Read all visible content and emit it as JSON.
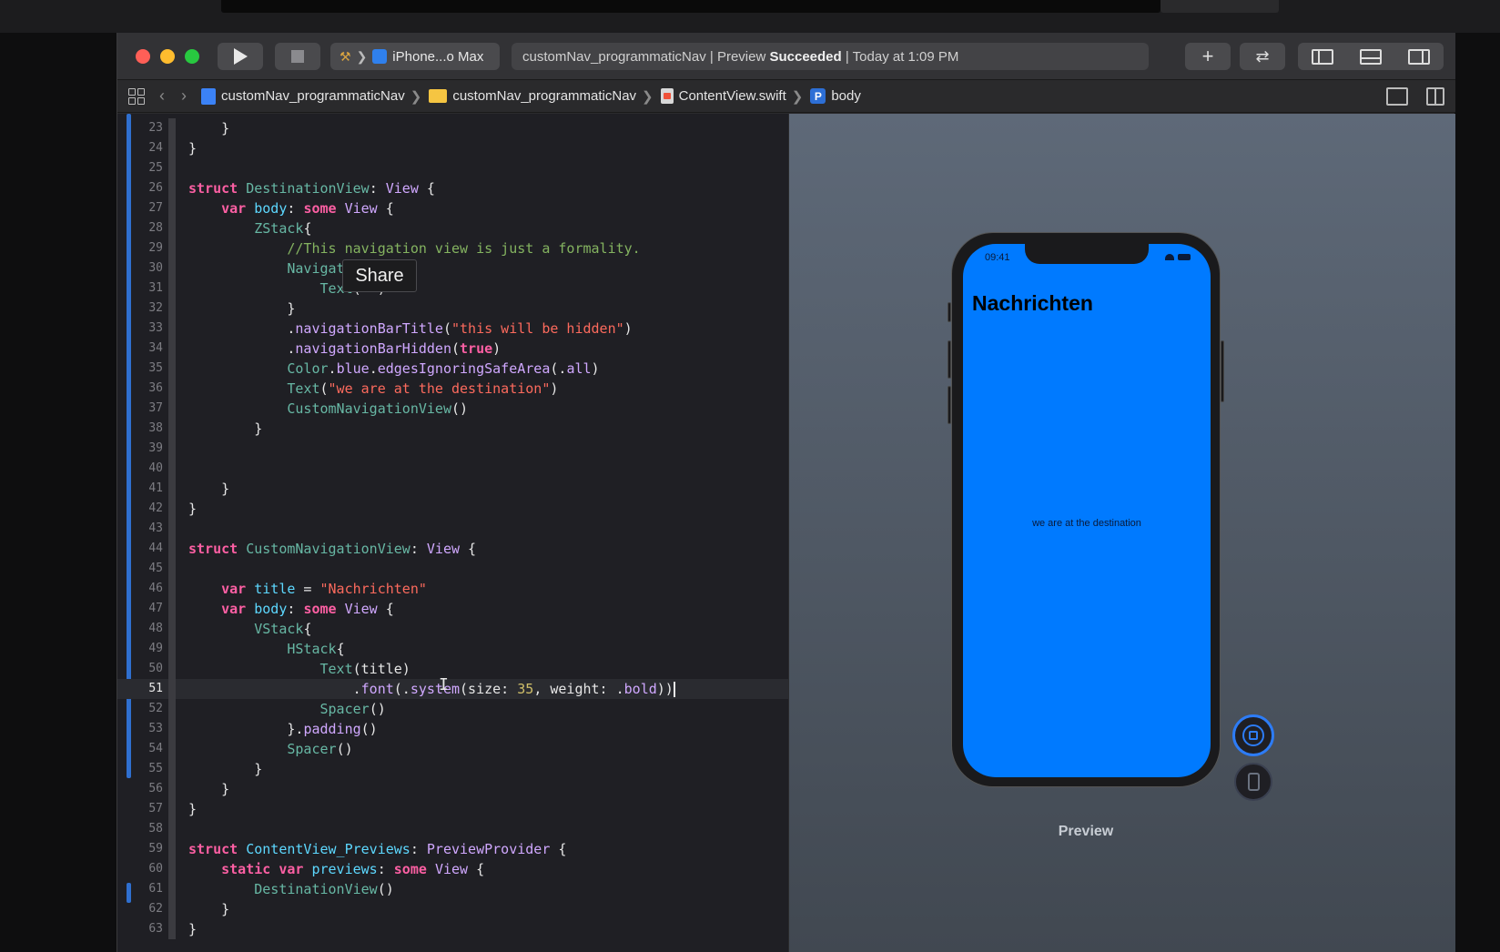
{
  "toolbar": {
    "scheme_device": "iPhone...o Max",
    "activity_project": "customNav_programmaticNav",
    "activity_sep1": " | Preview ",
    "activity_status": "Succeeded",
    "activity_sep2": " | Today at 1:09 PM"
  },
  "jumpbar": {
    "project": "customNav_programmaticNav",
    "folder": "customNav_programmaticNav",
    "file": "ContentView.swift",
    "symbol": "body"
  },
  "editor": {
    "tooltip": "Share",
    "current_line": 51,
    "lines": [
      {
        "n": "23",
        "code": "    }"
      },
      {
        "n": "24",
        "code": "}"
      },
      {
        "n": "25",
        "code": ""
      },
      {
        "n": "26",
        "code": "struct DestinationView: View {"
      },
      {
        "n": "27",
        "code": "    var body: some View {"
      },
      {
        "n": "28",
        "code": "        ZStack{"
      },
      {
        "n": "29",
        "code": "            //This navigation view is just a formality."
      },
      {
        "n": "30",
        "code": "            NavigationView{"
      },
      {
        "n": "31",
        "code": "                Text(\"\")"
      },
      {
        "n": "32",
        "code": "            }"
      },
      {
        "n": "33",
        "code": "            .navigationBarTitle(\"this will be hidden\")"
      },
      {
        "n": "34",
        "code": "            .navigationBarHidden(true)"
      },
      {
        "n": "35",
        "code": "            Color.blue.edgesIgnoringSafeArea(.all)"
      },
      {
        "n": "36",
        "code": "            Text(\"we are at the destination\")"
      },
      {
        "n": "37",
        "code": "            CustomNavigationView()"
      },
      {
        "n": "38",
        "code": "        }"
      },
      {
        "n": "39",
        "code": ""
      },
      {
        "n": "40",
        "code": ""
      },
      {
        "n": "41",
        "code": "    }"
      },
      {
        "n": "42",
        "code": "}"
      },
      {
        "n": "43",
        "code": ""
      },
      {
        "n": "44",
        "code": "struct CustomNavigationView: View {"
      },
      {
        "n": "45",
        "code": ""
      },
      {
        "n": "46",
        "code": "    var title = \"Nachrichten\""
      },
      {
        "n": "47",
        "code": "    var body: some View {"
      },
      {
        "n": "48",
        "code": "        VStack{"
      },
      {
        "n": "49",
        "code": "            HStack{"
      },
      {
        "n": "50",
        "code": "                Text(title)"
      },
      {
        "n": "51",
        "code": "                    .font(.system(size: 35, weight: .bold))"
      },
      {
        "n": "52",
        "code": "                Spacer()"
      },
      {
        "n": "53",
        "code": "            }.padding()"
      },
      {
        "n": "54",
        "code": "            Spacer()"
      },
      {
        "n": "55",
        "code": "        }"
      },
      {
        "n": "56",
        "code": "    }"
      },
      {
        "n": "57",
        "code": "}"
      },
      {
        "n": "58",
        "code": ""
      },
      {
        "n": "59",
        "code": "struct ContentView_Previews: PreviewProvider {"
      },
      {
        "n": "60",
        "code": "    static var previews: some View {"
      },
      {
        "n": "61",
        "code": "        DestinationView()"
      },
      {
        "n": "62",
        "code": "    }"
      },
      {
        "n": "63",
        "code": "}"
      }
    ]
  },
  "preview": {
    "status_time": "09:41",
    "nav_title": "Nachrichten",
    "body_text": "we are at the destination",
    "label": "Preview",
    "screen_color": "#007aff"
  },
  "colors": {
    "keyword": "#fc5fa3",
    "type": "#5dd8ff",
    "string": "#fc6a5d",
    "accent": "#2d7cf6"
  }
}
